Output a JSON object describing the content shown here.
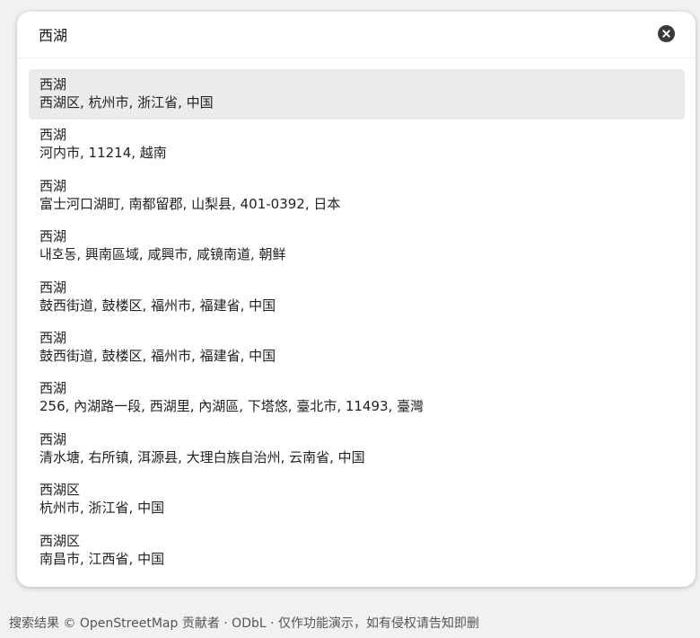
{
  "search": {
    "value": "西湖",
    "clear_icon": "close-circle-icon"
  },
  "results": [
    {
      "name": "西湖",
      "address": "西湖区, 杭州市, 浙江省, 中国",
      "selected": true
    },
    {
      "name": "西湖",
      "address": "河内市, 11214, 越南",
      "selected": false
    },
    {
      "name": "西湖",
      "address": "富士河口湖町, 南都留郡, 山梨县, 401-0392, 日本",
      "selected": false
    },
    {
      "name": "西湖",
      "address": "내호동, 興南區域, 咸興市, 咸镜南道, 朝鲜",
      "selected": false
    },
    {
      "name": "西湖",
      "address": "鼓西街道, 鼓楼区, 福州市, 福建省, 中国",
      "selected": false
    },
    {
      "name": "西湖",
      "address": "鼓西街道, 鼓楼区, 福州市, 福建省, 中国",
      "selected": false
    },
    {
      "name": "西湖",
      "address": "256, 內湖路一段, 西湖里, 內湖區, 下塔悠, 臺北市, 11493, 臺灣",
      "selected": false
    },
    {
      "name": "西湖",
      "address": "清水塘, 右所镇, 洱源县, 大理白族自治州, 云南省, 中国",
      "selected": false
    },
    {
      "name": "西湖区",
      "address": "杭州市, 浙江省, 中国",
      "selected": false
    },
    {
      "name": "西湖区",
      "address": "南昌市, 江西省, 中国",
      "selected": false
    }
  ],
  "footer": {
    "text": "搜索结果 © OpenStreetMap 贡献者 · ODbL · 仅作功能演示，如有侵权请告知即删"
  },
  "colors": {
    "page_bg": "#f1f1f1",
    "panel_bg": "#ffffff",
    "selected_bg": "#ebebeb",
    "clear_button": "#3a3a3a"
  }
}
